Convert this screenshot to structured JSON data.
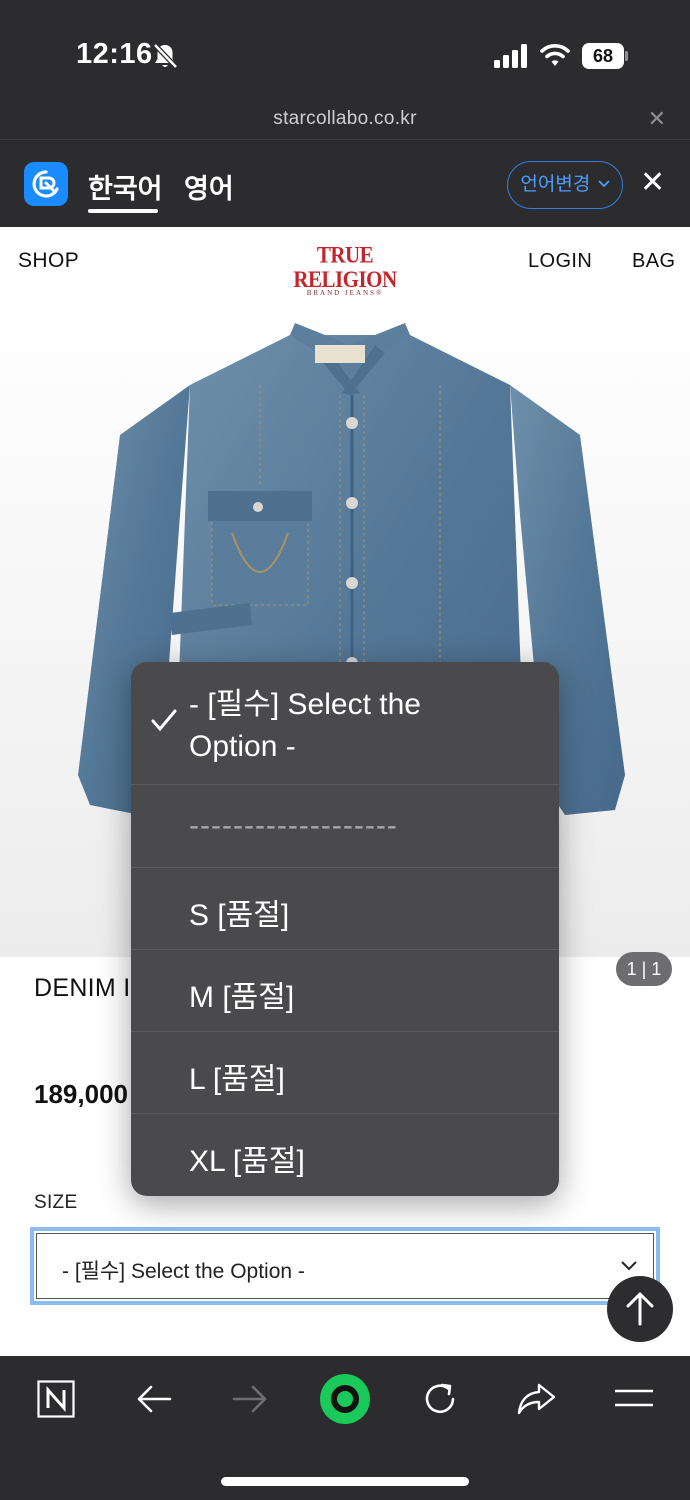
{
  "status_bar": {
    "time": "12:16",
    "battery": "68"
  },
  "url_bar": {
    "domain": "starcollabo.co.kr",
    "close_glyph": "✕"
  },
  "translator": {
    "tabs": [
      "한국어",
      "영어"
    ],
    "active_tab": 0,
    "change_language_label": "언어변경",
    "close_glyph": "✕",
    "accent_color": "#1a8cff"
  },
  "header": {
    "shop_label": "SHOP",
    "login_label": "LOGIN",
    "bag_label": "BAG",
    "brand_name": "TRUE RELIGION",
    "brand_sub": "BRAND JEANS®"
  },
  "product": {
    "image_counter": "1 | 1",
    "name": "DENIM I",
    "price": "189,000",
    "size_label": "SIZE",
    "size_selected": "- [필수] Select the Option -"
  },
  "picker": {
    "selected_index": 0,
    "options": [
      "- [필수] Select the Option -",
      "-------------------",
      "S [품절]",
      "M [품절]",
      "L [품절]",
      "XL [품절]"
    ]
  },
  "icons": {
    "status": [
      "bell-slash-icon",
      "signal-icon",
      "wifi-icon",
      "battery-icon"
    ],
    "toolbar": [
      "naver-n-icon",
      "back-arrow-icon",
      "forward-arrow-icon",
      "green-dot-icon",
      "refresh-icon",
      "share-icon",
      "menu-icon"
    ],
    "toolbar_green": "#19c95a"
  }
}
